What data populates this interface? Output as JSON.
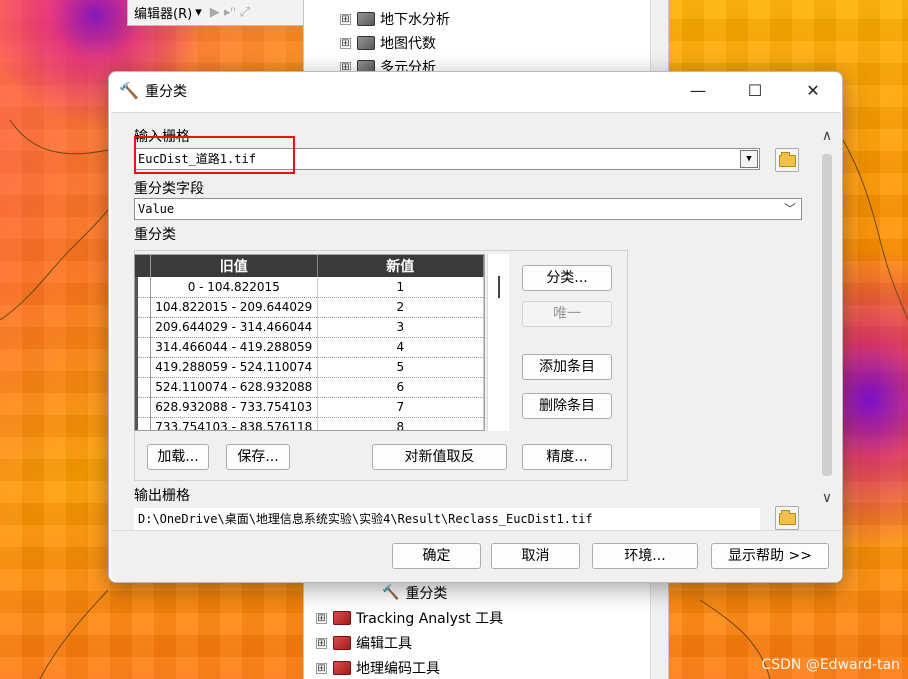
{
  "toolbar": {
    "editor_label": "编辑器(R)",
    "editor_arrow": "▾",
    "extra_icons": "▶ ▸ⁿ ⤢"
  },
  "toolbox": {
    "top_items": [
      {
        "expander": "⊞",
        "label": "地下水分析"
      },
      {
        "expander": "⊞",
        "label": "地图代数"
      },
      {
        "expander": "⊞",
        "label": "多元分析"
      }
    ],
    "selected_tool": "重分类",
    "bottom_items": [
      {
        "expander": "⊞",
        "label": "Tracking Analyst 工具"
      },
      {
        "expander": "⊞",
        "label": "编辑工具"
      },
      {
        "expander": "⊞",
        "label": "地理编码工具"
      }
    ]
  },
  "dialog": {
    "title": "重分类",
    "title_icon": "🔨",
    "window_controls": {
      "minimize": "—",
      "maximize": "☐",
      "close": "✕"
    },
    "input_raster_label": "输入栅格",
    "input_raster_value": "EucDist_道路1.tif",
    "reclass_field_label": "重分类字段",
    "reclass_field_value": "Value",
    "reclass_label": "重分类",
    "table": {
      "headers": [
        "旧值",
        "新值"
      ],
      "rows": [
        {
          "old": "0 - 104.822015",
          "new": "1"
        },
        {
          "old": "104.822015 - 209.644029",
          "new": "2"
        },
        {
          "old": "209.644029 - 314.466044",
          "new": "3"
        },
        {
          "old": "314.466044 - 419.288059",
          "new": "4"
        },
        {
          "old": "419.288059 - 524.110074",
          "new": "5"
        },
        {
          "old": "524.110074 - 628.932088",
          "new": "6"
        },
        {
          "old": "628.932088 - 733.754103",
          "new": "7"
        },
        {
          "old": "733.754103 - 838.576118",
          "new": "8"
        }
      ]
    },
    "side_buttons": {
      "classify": "分类...",
      "unique": "唯一",
      "add_entry": "添加条目",
      "delete_entry": "删除条目"
    },
    "bottom_buttons": {
      "load": "加载...",
      "save": "保存...",
      "reverse": "对新值取反",
      "precision": "精度..."
    },
    "output_raster_label": "输出栅格",
    "output_raster_value": "D:\\OneDrive\\桌面\\地理信息系统实验\\实验4\\Result\\Reclass_EucDist1.tif",
    "footer": {
      "ok": "确定",
      "cancel": "取消",
      "env": "环境...",
      "help": "显示帮助 >>"
    },
    "scroll": {
      "up": "∧",
      "down": "∨"
    }
  },
  "watermark": "CSDN @Edward-tan"
}
